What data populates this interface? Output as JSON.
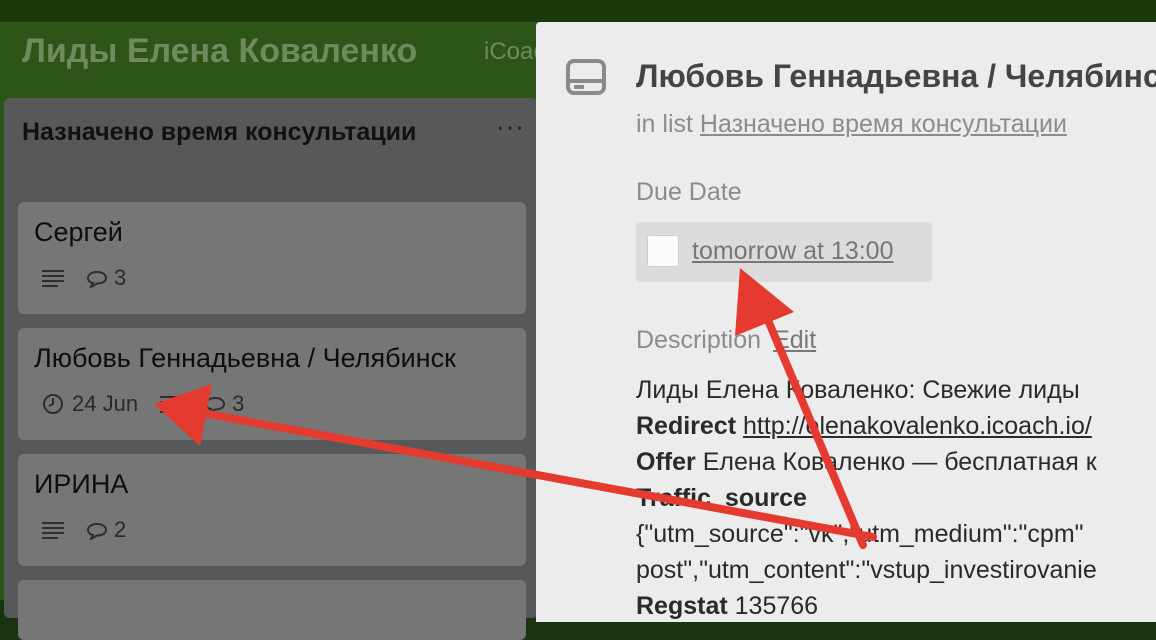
{
  "board": {
    "title": "Лиды Елена Коваленко",
    "team": "iCoach"
  },
  "list": {
    "title": "Назначено время консультации",
    "menu_label": "···",
    "cards": [
      {
        "title": "Сергей",
        "comments": "3"
      },
      {
        "title": "Любовь Геннадьевна / Челябинск",
        "due": "24 Jun",
        "comments": "3"
      },
      {
        "title": "ИРИНА",
        "comments": "2"
      }
    ]
  },
  "detail": {
    "title": "Любовь Геннадьевна / Челябинск",
    "in_list_prefix": "in list",
    "in_list_name": "Назначено время консультации",
    "due_label": "Due Date",
    "due_value": "tomorrow at 13:00",
    "description_label": "Description",
    "edit_label": "Edit",
    "description": {
      "line1": "Лиды Елена Коваленко: Свежие лиды",
      "redirect_key": "Redirect",
      "redirect_value": "http://elenakovalenko.icoach.io/",
      "offer_key": "Offer",
      "offer_value": "Елена Коваленко — бесплатная к",
      "traffic_key": "Traffic_source",
      "traffic_line1": "{\"utm_source\":\"vk\",\"utm_medium\":\"cpm\"",
      "traffic_line2": "post\",\"utm_content\":\"vstup_investirovanie",
      "regstat_key": "Regstat",
      "regstat_value": "135766"
    }
  },
  "colors": {
    "board_bg": "#2c5517",
    "annotation_arrow": "#e53a2f"
  },
  "icons": [
    "description-lines-icon",
    "comment-icon",
    "clock-icon",
    "card-icon"
  ]
}
